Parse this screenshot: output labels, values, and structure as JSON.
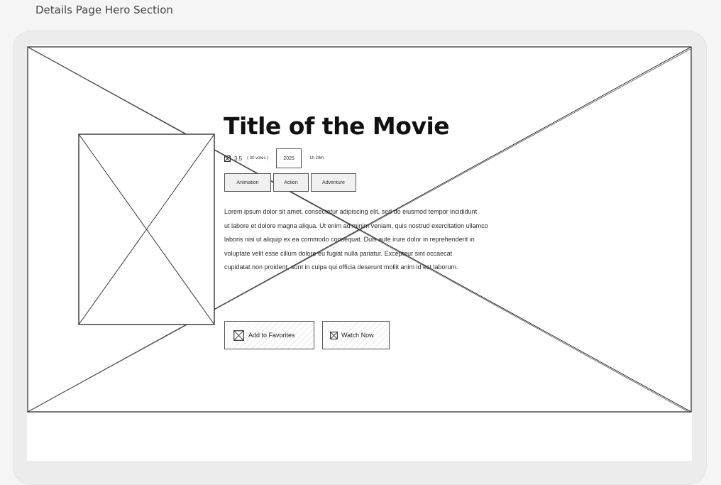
{
  "page_label": "Details Page Hero Section",
  "movie": {
    "title": "Title of the Movie",
    "rating": "3.5",
    "votes": "( 30 votes )",
    "year": "2025",
    "duration": "1h 29m",
    "genres": [
      "Animation",
      "Action",
      "Adventure"
    ],
    "description_lines": [
      "Lorem ipsum dolor sit amet, consectetur adipiscing elit, sed do eiusmod tempor incididunt",
      "ut labore et dolore magna aliqua. Ut enim ad minim veniam, quis nostrud exercitation ullamco",
      " laboris nisi ut aliquip ex ea commodo consequat. Duis aute irure dolor in reprehenderit in",
      "voluptate velit esse cillum dolore eu fugiat nulla pariatur. Excepteur sint occaecat",
      "cupidatat non proident, sunt in culpa qui officia deserunt mollit anim id est laborum."
    ]
  },
  "actions": {
    "favorites_label": "Add to Favorites",
    "watch_label": "Watch Now"
  },
  "icons": {
    "star": "placeholder-x-icon",
    "favorites": "placeholder-x-icon",
    "watch": "placeholder-x-icon"
  }
}
